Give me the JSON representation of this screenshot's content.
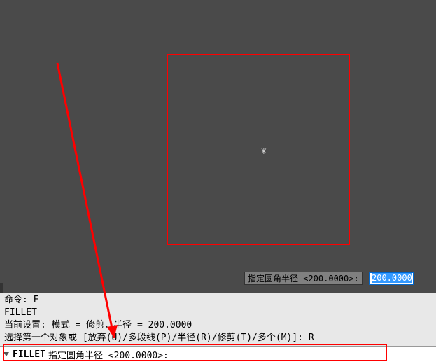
{
  "canvas": {
    "crosshair_glyph": "✳"
  },
  "tooltip": {
    "label": "指定圆角半径 <200.0000>:",
    "input_value": "200.0000"
  },
  "history": {
    "line1": "命令: F",
    "line2": "FILLET",
    "line3": "当前设置: 模式 = 修剪，半径 = 200.0000",
    "line4": "选择第一个对象或 [放弃(U)/多段线(P)/半径(R)/修剪(T)/多个(M)]: R"
  },
  "command_bar": {
    "command_name": "FILLET",
    "prompt": "指定圆角半径 <200.0000>:"
  }
}
